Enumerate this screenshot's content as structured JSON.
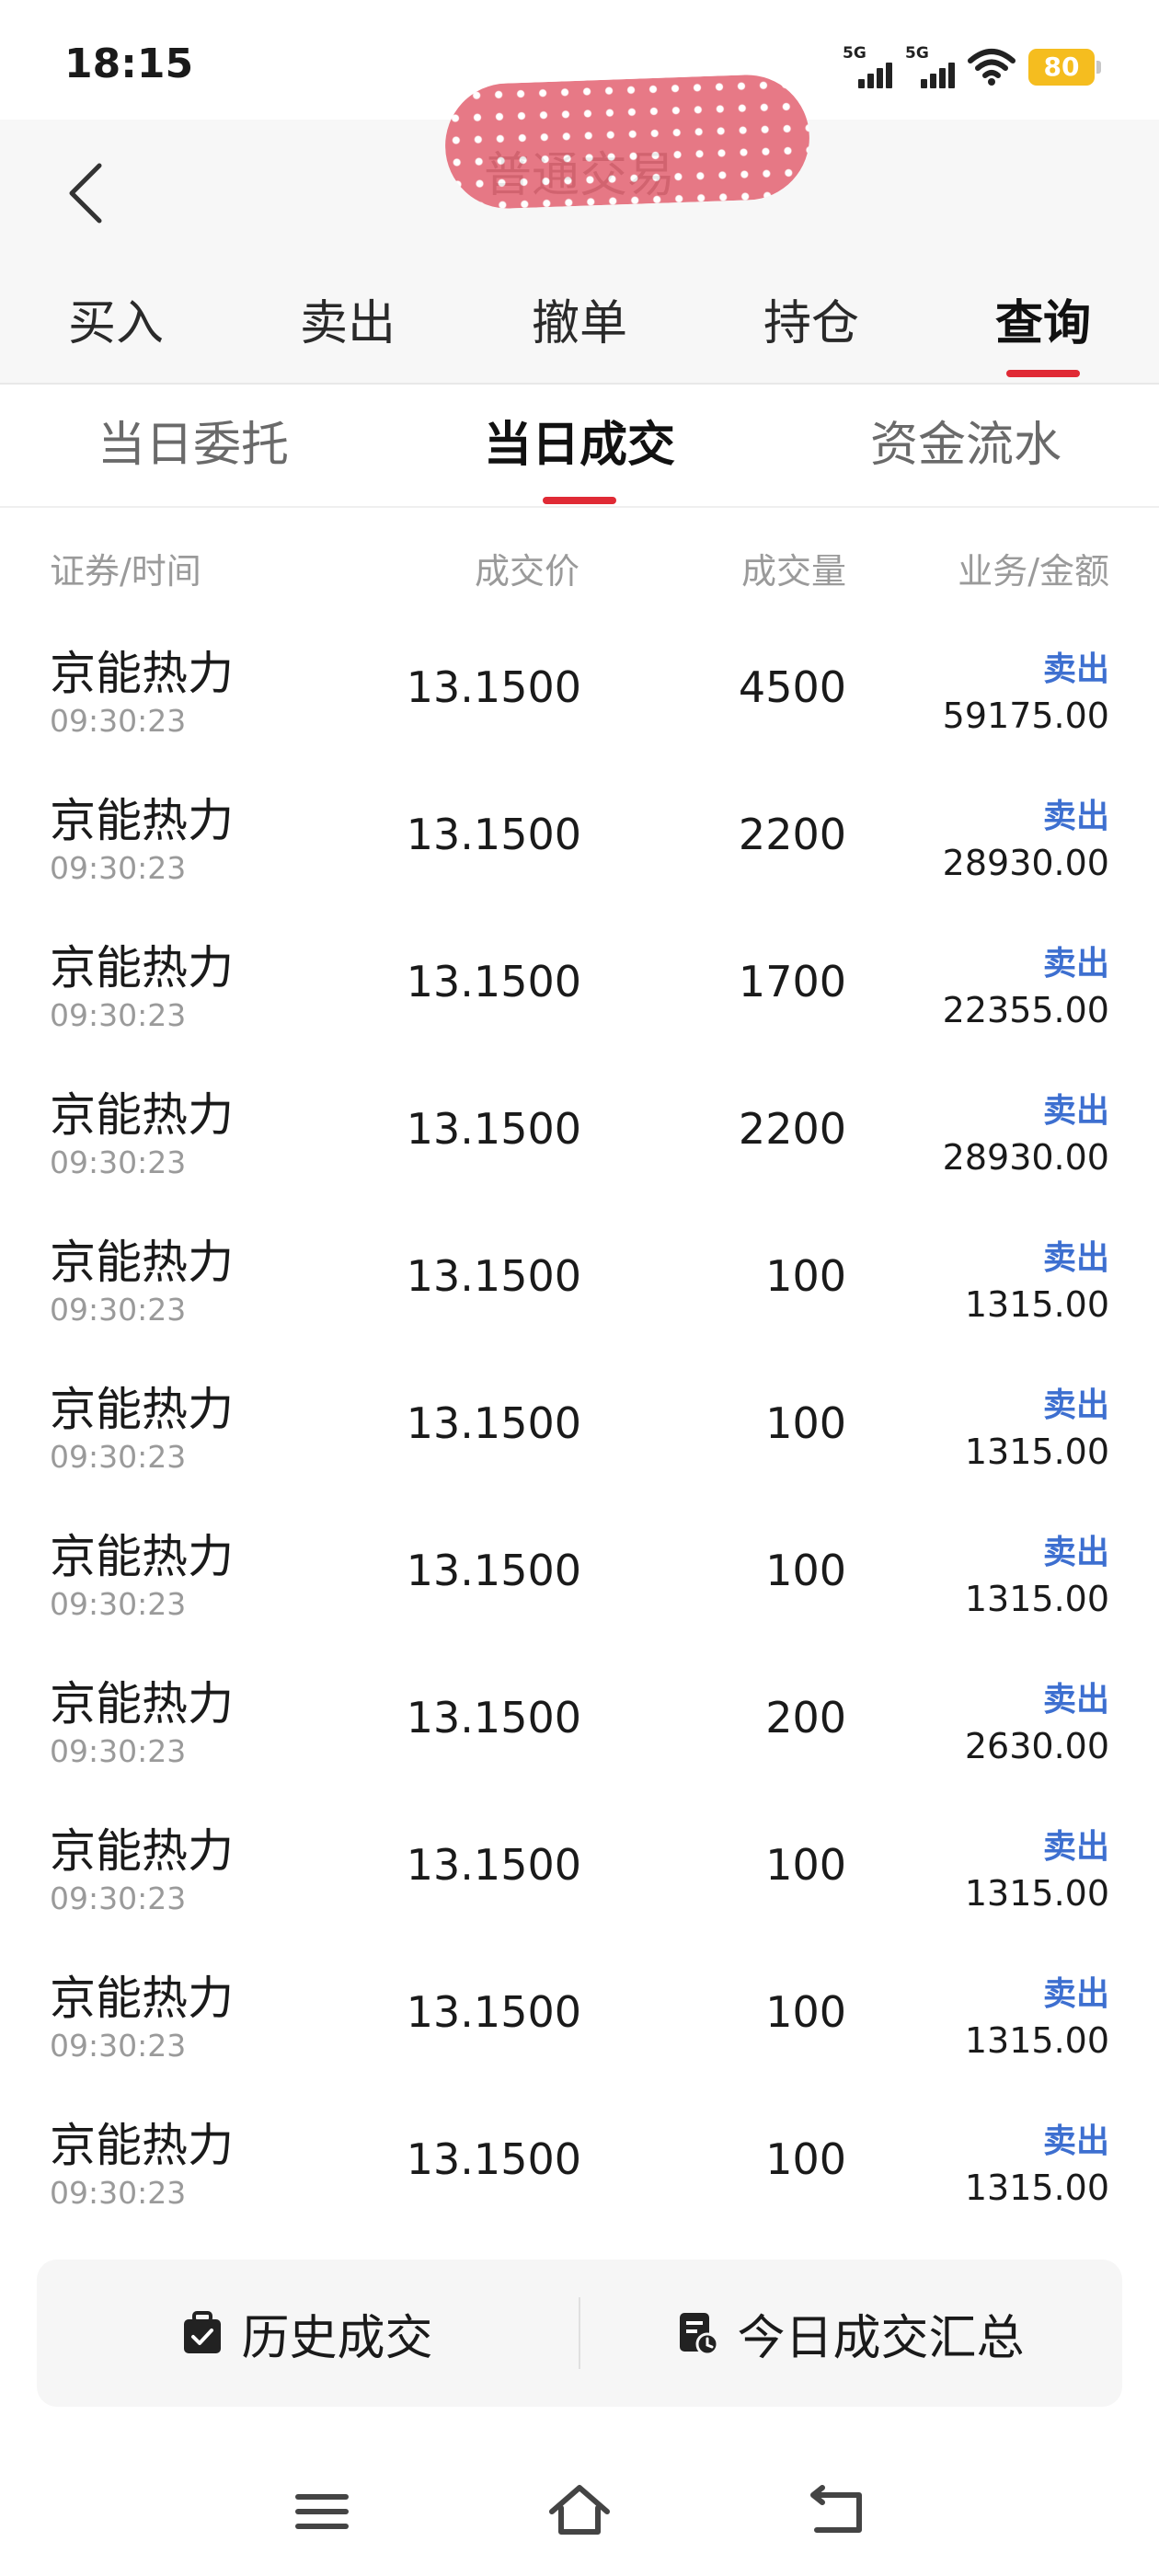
{
  "status_bar": {
    "time": "18:15",
    "signal_1_label": "5G",
    "signal_2_label": "5G",
    "battery": "80",
    "icons": [
      "signal-5g-icon",
      "signal-5g-icon",
      "wifi-icon",
      "battery-icon"
    ]
  },
  "header": {
    "title": "普通交易",
    "back_icon": "chevron-left-icon"
  },
  "main_tabs": [
    {
      "label": "买入",
      "active": false
    },
    {
      "label": "卖出",
      "active": false
    },
    {
      "label": "撤单",
      "active": false
    },
    {
      "label": "持仓",
      "active": false
    },
    {
      "label": "查询",
      "active": true
    }
  ],
  "sub_tabs": [
    {
      "label": "当日委托",
      "active": false
    },
    {
      "label": "当日成交",
      "active": true
    },
    {
      "label": "资金流水",
      "active": false
    }
  ],
  "table": {
    "headers": [
      "证券/时间",
      "成交价",
      "成交量",
      "业务/金额"
    ],
    "rows": [
      {
        "name": "京能热力",
        "time": "09:30:23",
        "price": "13.1500",
        "qty": "4500",
        "op": "卖出",
        "amount": "59175.00"
      },
      {
        "name": "京能热力",
        "time": "09:30:23",
        "price": "13.1500",
        "qty": "2200",
        "op": "卖出",
        "amount": "28930.00"
      },
      {
        "name": "京能热力",
        "time": "09:30:23",
        "price": "13.1500",
        "qty": "1700",
        "op": "卖出",
        "amount": "22355.00"
      },
      {
        "name": "京能热力",
        "time": "09:30:23",
        "price": "13.1500",
        "qty": "2200",
        "op": "卖出",
        "amount": "28930.00"
      },
      {
        "name": "京能热力",
        "time": "09:30:23",
        "price": "13.1500",
        "qty": "100",
        "op": "卖出",
        "amount": "1315.00"
      },
      {
        "name": "京能热力",
        "time": "09:30:23",
        "price": "13.1500",
        "qty": "100",
        "op": "卖出",
        "amount": "1315.00"
      },
      {
        "name": "京能热力",
        "time": "09:30:23",
        "price": "13.1500",
        "qty": "100",
        "op": "卖出",
        "amount": "1315.00"
      },
      {
        "name": "京能热力",
        "time": "09:30:23",
        "price": "13.1500",
        "qty": "200",
        "op": "卖出",
        "amount": "2630.00"
      },
      {
        "name": "京能热力",
        "time": "09:30:23",
        "price": "13.1500",
        "qty": "100",
        "op": "卖出",
        "amount": "1315.00"
      },
      {
        "name": "京能热力",
        "time": "09:30:23",
        "price": "13.1500",
        "qty": "100",
        "op": "卖出",
        "amount": "1315.00"
      },
      {
        "name": "京能热力",
        "time": "09:30:23",
        "price": "13.1500",
        "qty": "100",
        "op": "卖出",
        "amount": "1315.00"
      }
    ]
  },
  "bottom_actions": {
    "history_label": "历史成交",
    "history_icon": "briefcase-check-icon",
    "summary_label": "今日成交汇总",
    "summary_icon": "document-clock-icon"
  },
  "nav_bar": {
    "icons": [
      "menu-icon",
      "home-icon",
      "back-icon"
    ]
  },
  "colors": {
    "accent_red": "#e02a35",
    "op_blue": "#3d6fd0",
    "battery_yellow": "#f5bd1f"
  }
}
